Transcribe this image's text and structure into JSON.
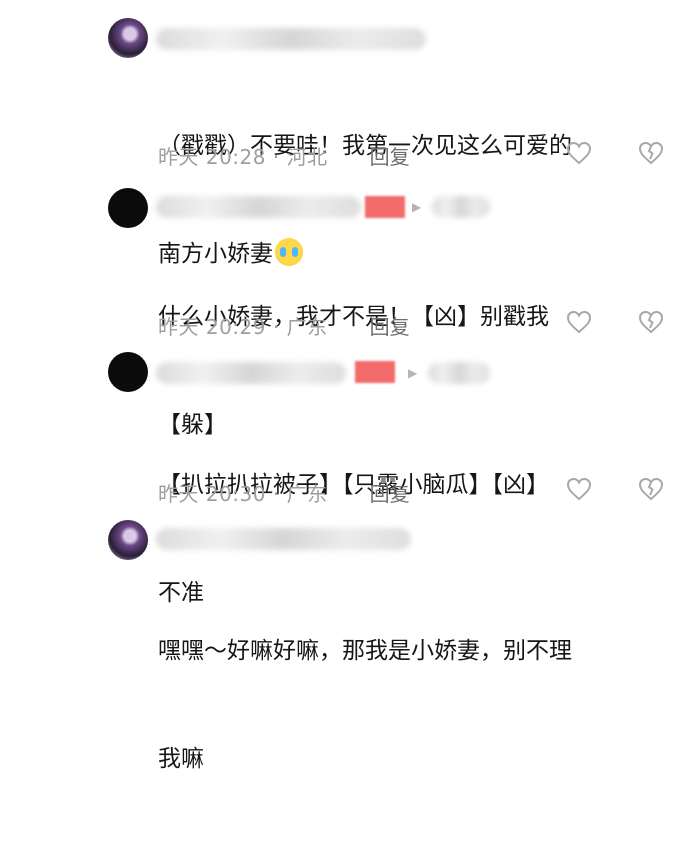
{
  "comments": [
    {
      "text_line1": "（戳戳）不要哇！我第一次见这么可爱的",
      "text_line2": "南方小娇妻",
      "emoji": "loudly-crying-face-icon",
      "time": "昨天 20:28 · 河北",
      "reply": "回复"
    },
    {
      "text_line1": "什么小娇妻，我才不是！【凶】别戳我",
      "text_line2": "【躲】",
      "time": "昨天 20:29 · 广东",
      "reply": "回复"
    },
    {
      "text_line1": "【扒拉扒拉被子】【只露小脑瓜】【凶】",
      "text_line2": "不准",
      "time": "昨天 20:30 · 广东",
      "reply": "回复"
    },
    {
      "text_line1": "嘿嘿～好嘛好嘛，那我是小娇妻，别不理",
      "text_line2": "我嘛"
    }
  ],
  "colors": {
    "text": "#161616",
    "meta": "#9e9e9e",
    "tag_red": "#f26a6a"
  }
}
